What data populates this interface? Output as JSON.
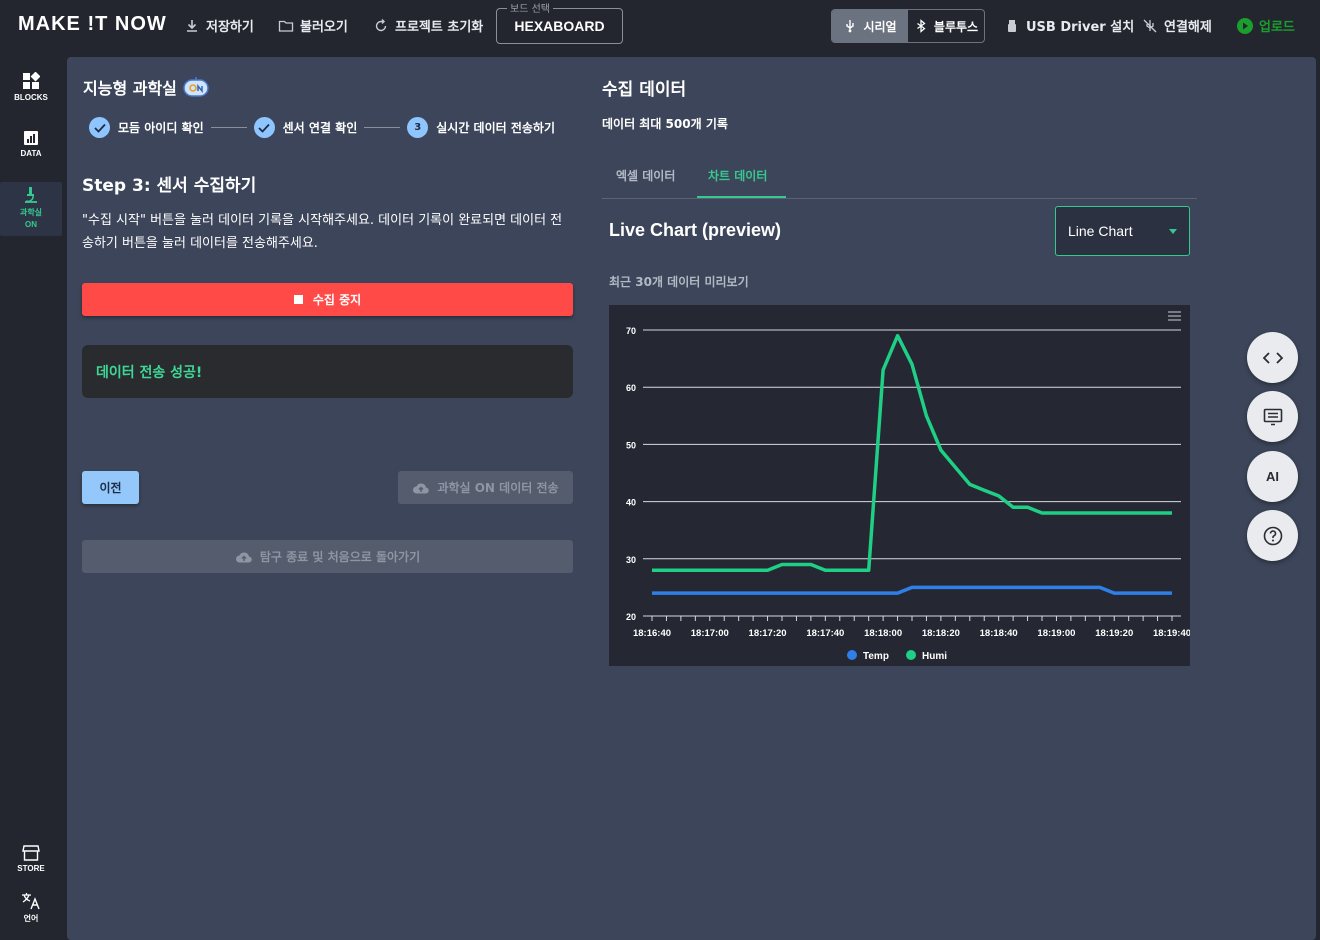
{
  "app": {
    "logo": "MAKE !T NOW"
  },
  "toolbar": {
    "save": "저장하기",
    "load": "불러오기",
    "reset": "프로젝트 초기화",
    "board_legend": "보드 선택",
    "board_value": "HEXABOARD",
    "serial": "시리얼",
    "bluetooth": "블루투스",
    "usb_driver": "USB Driver 설치",
    "disconnect": "연결해제",
    "upload": "업로드"
  },
  "sidenav": {
    "blocks": "BLOCKS",
    "data": "DATA",
    "science_1": "과학실",
    "science_2": "ON",
    "store": "STORE",
    "language": "언어"
  },
  "left": {
    "title": "지능형 과학실",
    "steps": [
      "모듬 아이디 확인",
      "센서 연결 확인",
      "실시간 데이터 전송하기"
    ],
    "step3_number": "3",
    "step_title": "Step 3: 센서 수집하기",
    "step_desc": "\"수집 시작\" 버튼을 눌러 데이터 기록을 시작해주세요. 데이터 기록이 완료되면 데이터 전송하기 버튼을 눌러 데이터를 전송해주세요.",
    "stop_button": "수집 중지",
    "success_message": "데이터 전송 성공!",
    "prev_button": "이전",
    "send_button": "과학실 ON 데이터 전송",
    "end_button": "탐구 종료 및 처음으로 돌아가기"
  },
  "right": {
    "title": "수집 데이터",
    "subtitle": "데이터 최대 500개 기록",
    "tabs": [
      "엑셀 데이터",
      "차트 데이터"
    ],
    "active_tab": "차트 데이터",
    "chart_title": "Live Chart (preview)",
    "chart_type_select": "Line Chart",
    "chart_caption": "최근 30개 데이터 미리보기"
  },
  "fab": {
    "ai": "AI"
  },
  "colors": {
    "accent": "#36c98f",
    "stop": "#ff4a48",
    "temp": "#2f7fe8",
    "humi": "#1fcf85"
  },
  "chart_data": {
    "type": "line",
    "x": [
      "18:16:40",
      "18:16:45",
      "18:16:50",
      "18:16:55",
      "18:17:00",
      "18:17:05",
      "18:17:10",
      "18:17:15",
      "18:17:20",
      "18:17:25",
      "18:17:30",
      "18:17:35",
      "18:17:40",
      "18:17:45",
      "18:17:50",
      "18:17:55",
      "18:18:00",
      "18:18:05",
      "18:18:10",
      "18:18:15",
      "18:18:20",
      "18:18:25",
      "18:18:30",
      "18:18:35",
      "18:18:40",
      "18:18:45",
      "18:18:50",
      "18:18:55",
      "18:19:00",
      "18:19:05",
      "18:19:10",
      "18:19:15",
      "18:19:20",
      "18:19:25",
      "18:19:30",
      "18:19:35",
      "18:19:40"
    ],
    "xticks": [
      "18:16:40",
      "18:17:00",
      "18:17:20",
      "18:17:40",
      "18:18:00",
      "18:18:20",
      "18:18:40",
      "18:19:00",
      "18:19:20",
      "18:19:40"
    ],
    "series": [
      {
        "name": "Temp",
        "color": "#2f7fe8",
        "values": [
          24,
          24,
          24,
          24,
          24,
          24,
          24,
          24,
          24,
          24,
          24,
          24,
          24,
          24,
          24,
          24,
          24,
          24,
          25,
          25,
          25,
          25,
          25,
          25,
          25,
          25,
          25,
          25,
          25,
          25,
          25,
          25,
          24,
          24,
          24,
          24,
          24
        ]
      },
      {
        "name": "Humi",
        "color": "#1fcf85",
        "values": [
          28,
          28,
          28,
          28,
          28,
          28,
          28,
          28,
          28,
          29,
          29,
          29,
          28,
          28,
          28,
          28,
          63,
          69,
          64,
          55,
          49,
          46,
          43,
          42,
          41,
          39,
          39,
          38,
          38,
          38,
          38,
          38,
          38,
          38,
          38,
          38,
          38
        ]
      }
    ],
    "yticks": [
      20,
      30,
      40,
      50,
      60,
      70
    ],
    "ylim": [
      20,
      70
    ],
    "legend": "bottom",
    "grid": true
  }
}
